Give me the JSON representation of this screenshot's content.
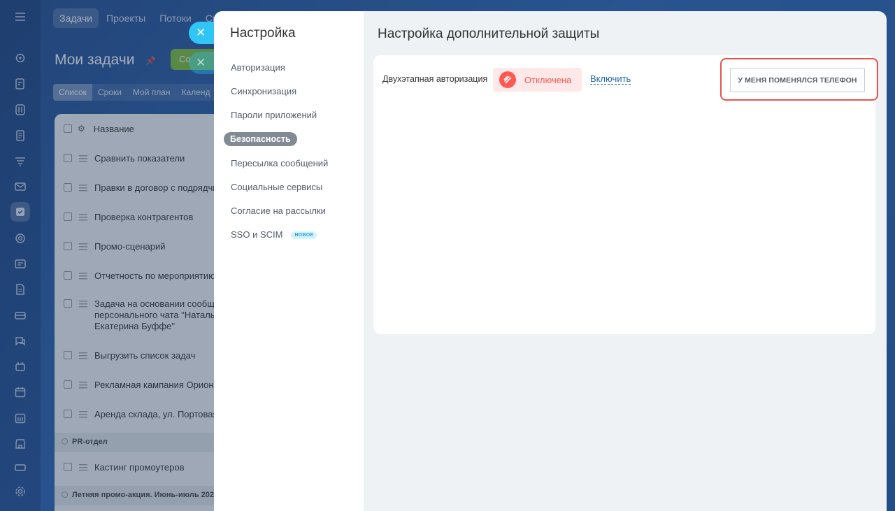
{
  "rail": {
    "icons": [
      "menu-icon",
      "feed-icon",
      "tasks-edit-icon",
      "drive-icon",
      "document-icon",
      "filter-icon",
      "mail-icon",
      "tasks-check-icon",
      "target-icon",
      "chat-icon",
      "file-icon",
      "inbox-icon",
      "messages-icon",
      "robot-icon",
      "calendar-icon",
      "calendar-grid-icon",
      "store-icon",
      "box-icon",
      "settings-icon"
    ]
  },
  "background": {
    "nav_tabs": [
      "Задачи",
      "Проекты",
      "Потоки",
      "Ск"
    ],
    "page_title": "Мои задачи",
    "create_button": "Со",
    "view_tabs": [
      "Список",
      "Сроки",
      "Мой план",
      "Календ"
    ],
    "table_header": "Название",
    "rows": [
      "Сравнить показатели",
      "Правки в договор с подрядчи",
      "Проверка контрагентов",
      "Промо-сценарий",
      "Отчетность по мероприятию",
      "Задача на основании сообще\nперсонального чата \"Наталья\nЕкатерина Буффе\"",
      "Выгрузить список задач",
      "Рекламная кампания Орион",
      "Аренда склада, ул. Портовая,"
    ],
    "group_1": "PR-отдел",
    "group_1_rows": [
      "Кастинг промоутеров"
    ],
    "group_2": "Летняя промо-акция. Июнь-июль 202"
  },
  "settings": {
    "title": "Настройка",
    "menu": [
      {
        "label": "Авторизация"
      },
      {
        "label": "Синхронизация"
      },
      {
        "label": "Пароли приложений"
      },
      {
        "label": "Безопасность"
      },
      {
        "label": "Пересылка сообщений"
      },
      {
        "label": "Социальные сервисы"
      },
      {
        "label": "Согласие на рассылки"
      },
      {
        "label": "SSO и SCIM",
        "badge": "НОВОЕ"
      }
    ],
    "active_item": "Безопасность",
    "content_title": "Настройка дополнительной защиты",
    "two_factor": {
      "label": "Двухэтапная авторизация",
      "status": "Отключена",
      "status_color": "#ff5752",
      "enable_link": "Включить",
      "phone_changed_button": "У МЕНЯ ПОМЕНЯЛСЯ ТЕЛЕФОН",
      "highlight_color": "#e8534f"
    }
  }
}
